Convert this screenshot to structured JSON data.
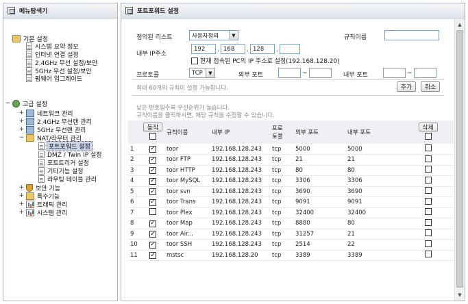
{
  "left_panel": {
    "title": "메뉴탐색기",
    "tree": [
      {
        "label": "기본 설정",
        "depth": 0,
        "expander": "",
        "icon": "folder-settings-icon",
        "icon_class": "ico-folder"
      },
      {
        "label": "시스템 요약 정보",
        "depth": 1,
        "expander": "",
        "icon": "page-icon",
        "icon_class": "ico-page"
      },
      {
        "label": "인터넷 연결 설정",
        "depth": 1,
        "expander": "",
        "icon": "page-icon",
        "icon_class": "ico-page"
      },
      {
        "label": "2.4GHz 무선 설정/보안",
        "depth": 1,
        "expander": "",
        "icon": "page-icon",
        "icon_class": "ico-page"
      },
      {
        "label": "5GHz 무선 설정/보안",
        "depth": 1,
        "expander": "",
        "icon": "page-icon",
        "icon_class": "ico-page"
      },
      {
        "label": "펌웨어 업그레이드",
        "depth": 1,
        "expander": "",
        "icon": "page-icon",
        "icon_class": "ico-page"
      },
      {
        "label": "고급 설정",
        "depth": 0,
        "expander": "−",
        "icon": "gear-icon",
        "icon_class": "ico-gear"
      },
      {
        "label": "네트워크 관리",
        "depth": 1,
        "expander": "+",
        "icon": "network-icon",
        "icon_class": "ico-net"
      },
      {
        "label": "2.4GHz 무선랜 관리",
        "depth": 1,
        "expander": "+",
        "icon": "network-icon",
        "icon_class": "ico-net"
      },
      {
        "label": "5GHz 무선랜 관리",
        "depth": 1,
        "expander": "+",
        "icon": "network-icon",
        "icon_class": "ico-net"
      },
      {
        "label": "NAT/라우터 관리",
        "depth": 1,
        "expander": "−",
        "icon": "folder-icon",
        "icon_class": "ico-folder"
      },
      {
        "label": "포트포워드 설정",
        "depth": 2,
        "expander": "",
        "icon": "page-icon",
        "icon_class": "ico-page",
        "selected": true
      },
      {
        "label": "DMZ / Twin IP 설정",
        "depth": 2,
        "expander": "",
        "icon": "page-icon",
        "icon_class": "ico-page"
      },
      {
        "label": "포트트리거 설정",
        "depth": 2,
        "expander": "",
        "icon": "page-icon",
        "icon_class": "ico-page"
      },
      {
        "label": "기타기능 설정",
        "depth": 2,
        "expander": "",
        "icon": "page-icon",
        "icon_class": "ico-page"
      },
      {
        "label": "라우팅 테이블 관리",
        "depth": 2,
        "expander": "",
        "icon": "page-icon",
        "icon_class": "ico-page"
      },
      {
        "label": "보안 기능",
        "depth": 1,
        "expander": "+",
        "icon": "shield-icon",
        "icon_class": "ico-shield"
      },
      {
        "label": "특수기능",
        "depth": 1,
        "expander": "+",
        "icon": "folder-icon",
        "icon_class": "ico-folder"
      },
      {
        "label": "트래픽 관리",
        "depth": 1,
        "expander": "+",
        "icon": "chart-icon",
        "icon_class": "ico-chart"
      },
      {
        "label": "시스템 관리",
        "depth": 1,
        "expander": "+",
        "icon": "chart-icon",
        "icon_class": "ico-chart"
      }
    ]
  },
  "right_panel": {
    "title": "포트포워드 설정",
    "form": {
      "preset_label": "정의된 리스트",
      "preset_value": "사용자정의",
      "rule_name_label": "규칙이름",
      "rule_name_value": "",
      "internal_ip_label": "내부 IP주소",
      "ip_octets": [
        "192",
        "168",
        "128",
        ""
      ],
      "current_pc_checkbox_label": "현재 접속된 PC의 IP 주소로 설정(192.168.128.20)",
      "current_pc_checked": false,
      "protocol_label": "프로토콜",
      "protocol_value": "TCP",
      "external_port_label": "외부 포트",
      "external_port_from": "",
      "external_port_to": "",
      "internal_port_label": "내부 포트",
      "internal_port_from": "",
      "internal_port_to": "",
      "max_rules_note": "최대 60개의 규칙이 설정 가능합니다.",
      "add_button": "추가",
      "cancel_button": "취소"
    },
    "hints": [
      "낮은 번호일수록 우선순위가 높습니다.",
      "규칙이름을 클릭하시면, 해당 규칙을 수정할 수 있습니다."
    ],
    "table": {
      "headers": {
        "active_button": "동작",
        "rule_name": "규칙이름",
        "internal_ip": "내부 IP",
        "protocol_line1": "프로",
        "protocol_line2": "토콜",
        "external_port": "외부 포트",
        "internal_port": "내부 포트",
        "delete_button": "삭제"
      },
      "rows": [
        {
          "num": "1",
          "active": true,
          "name": "toor",
          "ip": "192.168.128.243",
          "proto": "tcp",
          "ext": "5000",
          "int": "5000"
        },
        {
          "num": "2",
          "active": true,
          "name": "toor FTP",
          "ip": "192.168.128.243",
          "proto": "tcp",
          "ext": "21",
          "int": "21"
        },
        {
          "num": "3",
          "active": true,
          "name": "toor HTTP",
          "ip": "192.168.128.243",
          "proto": "tcp",
          "ext": "80",
          "int": "80"
        },
        {
          "num": "4",
          "active": true,
          "name": "toor MySQL",
          "ip": "192.168.128.243",
          "proto": "tcp",
          "ext": "3306",
          "int": "3306"
        },
        {
          "num": "5",
          "active": true,
          "name": "toor svn",
          "ip": "192.168.128.243",
          "proto": "tcp",
          "ext": "3690",
          "int": "3690"
        },
        {
          "num": "6",
          "active": true,
          "name": "toor Trans",
          "ip": "192.168.128.243",
          "proto": "tcp",
          "ext": "9091",
          "int": "9091"
        },
        {
          "num": "7",
          "active": false,
          "name": "toor Plex",
          "ip": "192.168.128.243",
          "proto": "tcp",
          "ext": "32400",
          "int": "32400"
        },
        {
          "num": "8",
          "active": true,
          "name": "toor Map",
          "ip": "192.168.128.243",
          "proto": "tcp",
          "ext": "8880",
          "int": "80"
        },
        {
          "num": "9",
          "active": true,
          "name": "toor Air...",
          "ip": "192.168.128.243",
          "proto": "tcp",
          "ext": "31257",
          "int": "21"
        },
        {
          "num": "10",
          "active": true,
          "name": "toor SSH",
          "ip": "192.168.128.243",
          "proto": "tcp",
          "ext": "2514",
          "int": "22"
        },
        {
          "num": "11",
          "active": true,
          "name": "mstsc",
          "ip": "192.168.128.20",
          "proto": "tcp",
          "ext": "3389",
          "int": "3389"
        }
      ]
    }
  }
}
